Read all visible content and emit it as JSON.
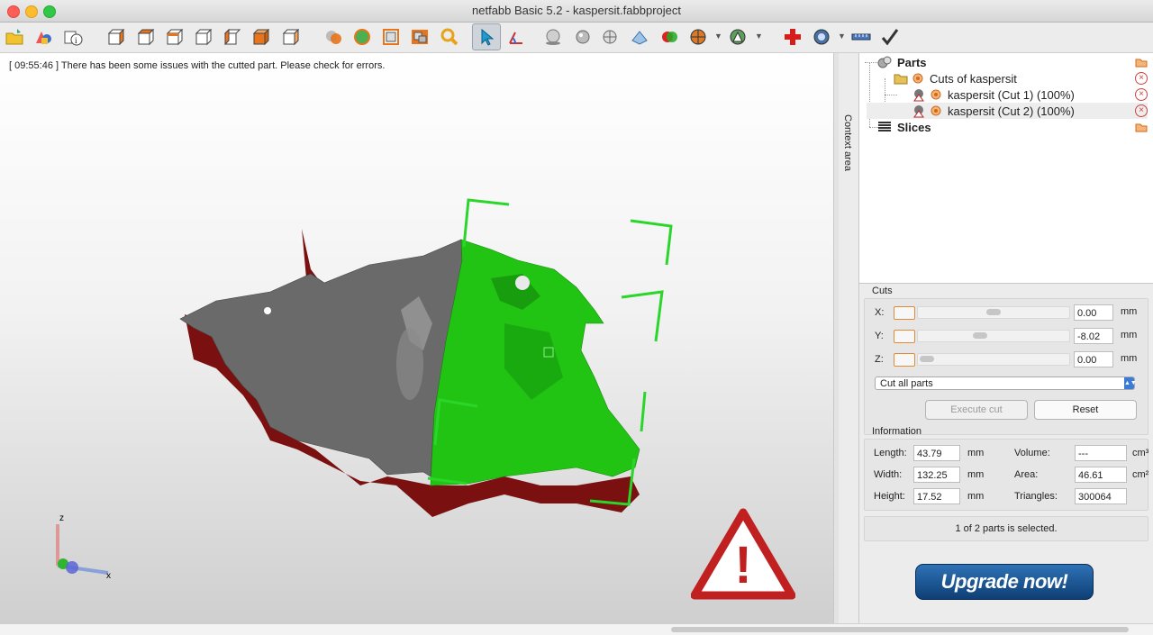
{
  "window": {
    "title": "netfabb Basic 5.2 - kaspersit.fabbproject"
  },
  "toolbar": {
    "tools": [
      "open-icon",
      "add-part-icon",
      "part-info-icon",
      "view-front-icon",
      "view-back-icon",
      "view-left-icon",
      "view-right-icon",
      "view-top-icon",
      "view-bottom-icon",
      "view-iso-icon",
      "repair-icon",
      "cut-icon",
      "measure-icon",
      "layout-icon",
      "zoom-icon",
      "select-icon",
      "rotate-icon",
      "sphere-icon",
      "shaded-icon",
      "mesh-icon",
      "wireframe-icon",
      "color-icon",
      "texture-icon",
      "analysis-icon",
      "plus-repair-icon",
      "camera-icon",
      "ruler-icon",
      "apply-icon"
    ]
  },
  "viewport": {
    "message": "[ 09:55:46 ]  There has been some issues with the cutted part. Please check for errors.",
    "axis_z": "z",
    "axis_x": "x",
    "warning_glyph": "!"
  },
  "context_area": {
    "label": "Context area"
  },
  "tree": {
    "parts": "Parts",
    "group": "Cuts of kaspersit",
    "cut1": "kaspersit (Cut 1) (100%)",
    "cut2": "kaspersit (Cut 2) (100%)",
    "slices": "Slices"
  },
  "cuts": {
    "title": "Cuts",
    "x_label": "X:",
    "x_value": "0.00",
    "y_label": "Y:",
    "y_value": "-8.02",
    "z_label": "Z:",
    "z_value": "0.00",
    "unit": "mm",
    "mode": "Cut all parts",
    "execute": "Execute cut",
    "reset": "Reset"
  },
  "info": {
    "title": "Information",
    "length_label": "Length:",
    "length": "43.79",
    "width_label": "Width:",
    "width": "132.25",
    "height_label": "Height:",
    "height": "17.52",
    "volume_label": "Volume:",
    "volume": "---",
    "area_label": "Area:",
    "area": "46.61",
    "triangles_label": "Triangles:",
    "triangles": "300064",
    "unit_mm": "mm",
    "unit_cm3": "cm³",
    "unit_cm2": "cm²"
  },
  "status": {
    "selection": "1 of 2 parts is selected."
  },
  "upgrade": {
    "label": "Upgrade now!"
  },
  "colors": {
    "model_gray": "#6a6a6a",
    "cut_green": "#22c414",
    "underside_red": "#7a1010",
    "bracket_green": "#2bd62b",
    "warning_red": "#c02020",
    "accent_blue": "#1d5fa4"
  }
}
